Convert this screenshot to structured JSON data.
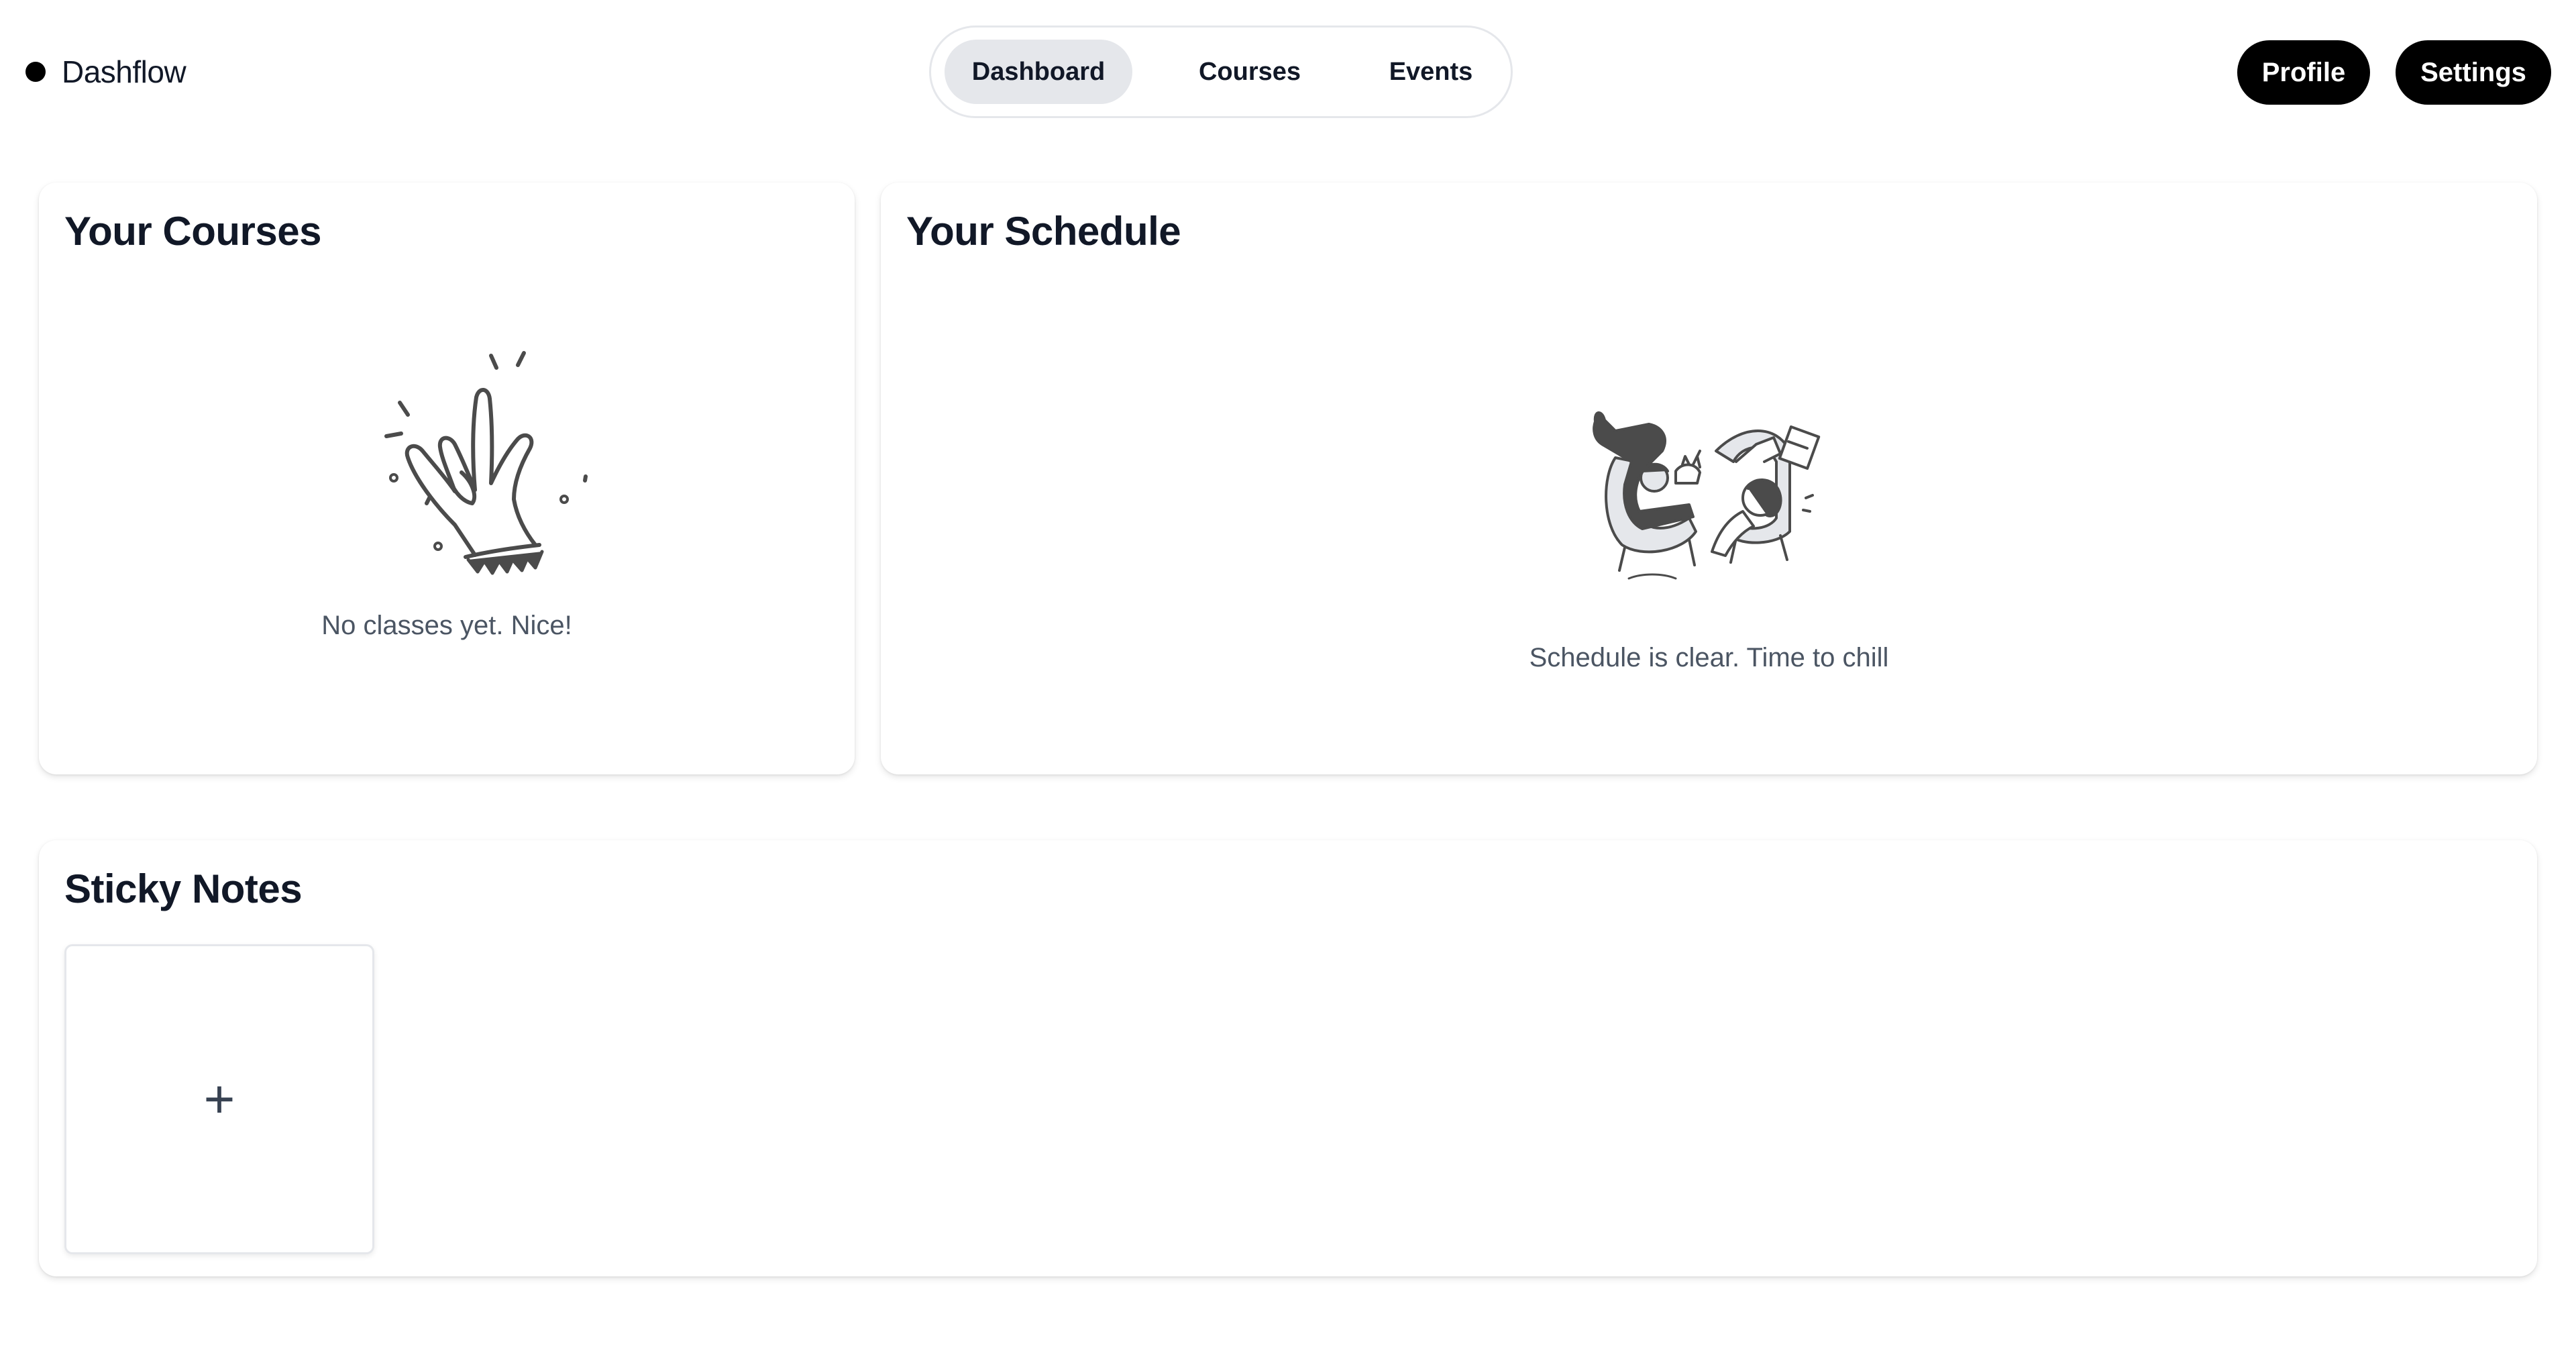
{
  "app": {
    "brand_name": "Dashflow",
    "brand_icon": "dot-icon"
  },
  "nav": {
    "tabs": [
      {
        "label": "Dashboard",
        "active": true
      },
      {
        "label": "Courses",
        "active": false
      },
      {
        "label": "Events",
        "active": false
      }
    ]
  },
  "header_actions": {
    "profile_label": "Profile",
    "settings_label": "Settings"
  },
  "courses_card": {
    "title": "Your Courses",
    "empty_text": "No classes yet. Nice!",
    "illustration": "waving-hand-illustration"
  },
  "schedule_card": {
    "title": "Your Schedule",
    "empty_text": "Schedule is clear. Time to chill",
    "illustration": "relaxing-people-illustration"
  },
  "notes_card": {
    "title": "Sticky Notes",
    "add_symbol": "+"
  },
  "colors": {
    "accent": "#000000",
    "nav_active_bg": "#e5e7eb",
    "muted_text": "#4b5563"
  }
}
